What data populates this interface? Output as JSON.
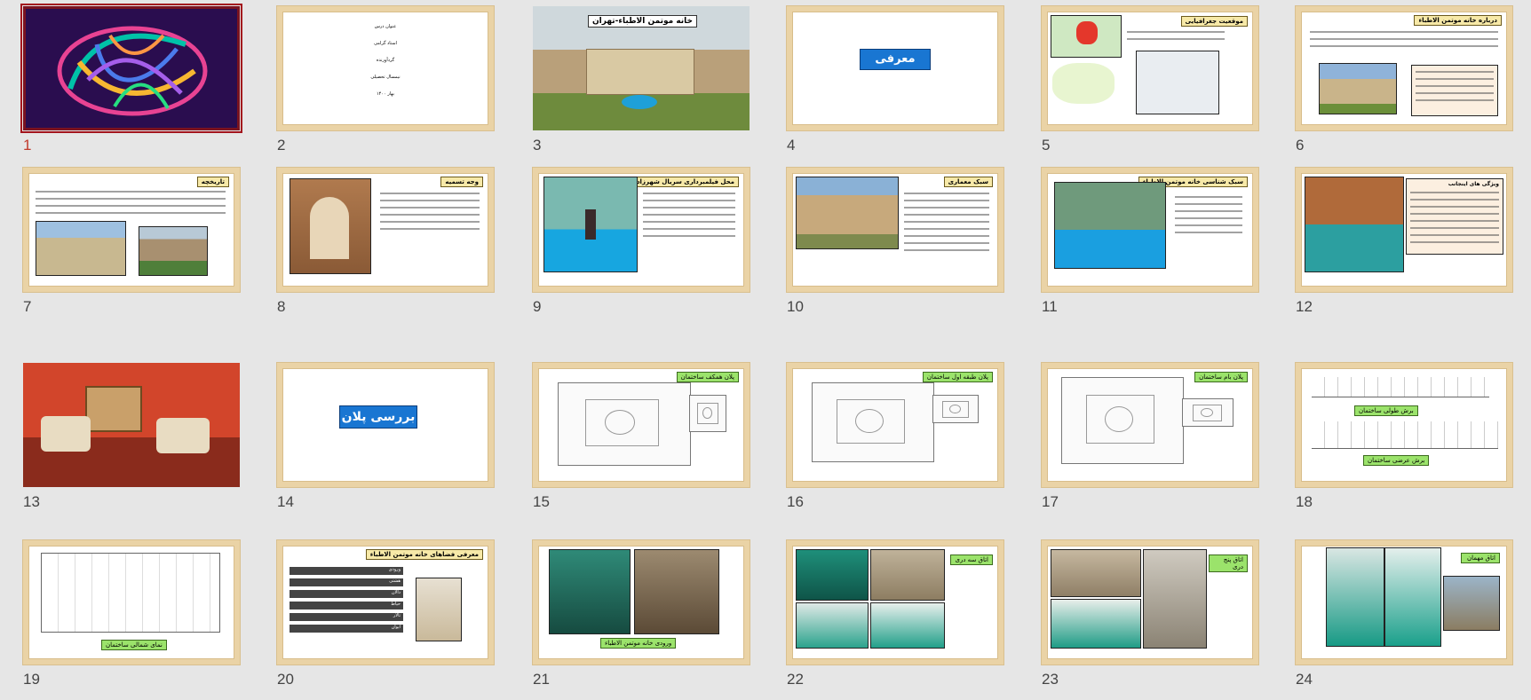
{
  "slides": [
    {
      "n": "1",
      "selected": true
    },
    {
      "n": "2",
      "lines": [
        "عنوان درس",
        "استاد گرامی",
        "گردآورنده",
        "نیمسال تحصیلی",
        "بهار ۱۴۰۰"
      ]
    },
    {
      "n": "3",
      "title": "خانه موتمن الاطباء-تهران"
    },
    {
      "n": "4",
      "title": "معرفی"
    },
    {
      "n": "5",
      "title": "موقعیت جغرافیایی"
    },
    {
      "n": "6",
      "title": "درباره خانه موتمن الاطباء"
    },
    {
      "n": "7",
      "title": "تاریخچه"
    },
    {
      "n": "8",
      "title": "وجه تسمیه"
    },
    {
      "n": "9",
      "title": "محل فیلمبرداری سریال شهرزاد"
    },
    {
      "n": "10",
      "title": "سبک معماری"
    },
    {
      "n": "11",
      "title": "سبک شناسی خانه موتمن الاطباء"
    },
    {
      "n": "12",
      "title": "ویژگی های اینجانب"
    },
    {
      "n": "13"
    },
    {
      "n": "14",
      "title": "بررسی پلان"
    },
    {
      "n": "15",
      "title": "پلان همکف ساختمان"
    },
    {
      "n": "16",
      "title": "پلان طبقه اول ساختمان"
    },
    {
      "n": "17",
      "title": "پلان بام ساختمان"
    },
    {
      "n": "18",
      "captions": [
        "برش طولی ساختمان",
        "برش عرضی ساختمان"
      ]
    },
    {
      "n": "19",
      "caption": "نمای شمالی ساختمان"
    },
    {
      "n": "20",
      "title": "معرفی فضاهای خانه موتمن الاطباء",
      "items": [
        "ورودی",
        "هشتی",
        "دالان",
        "حیاط",
        "تالار",
        "ایوان"
      ]
    },
    {
      "n": "21",
      "caption": "ورودی خانه موتمن الاطباء"
    },
    {
      "n": "22",
      "title": "اتاق سه دری"
    },
    {
      "n": "23",
      "title": "اتاق پنج دری"
    },
    {
      "n": "24",
      "title": "اتاق مهمان"
    }
  ],
  "colors": {
    "selected_number": "#c0392b",
    "frame": "#ead3a6",
    "blue_button": "#1976d2",
    "label_green": "#9be36b"
  }
}
